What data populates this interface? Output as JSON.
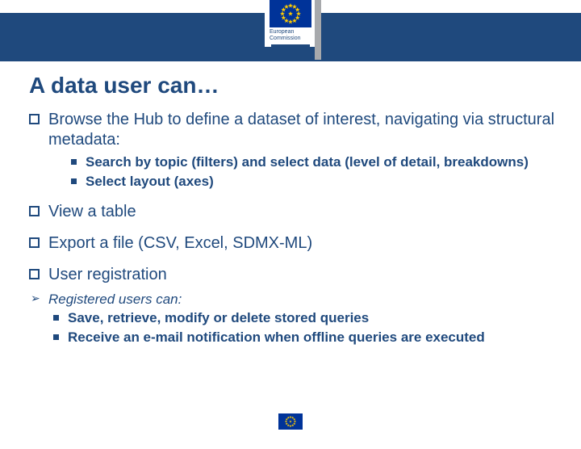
{
  "logo": {
    "caption_l1": "European",
    "caption_l2": "Commission"
  },
  "title": "A data user can…",
  "bullets": {
    "b1": "Browse the Hub to define a dataset of interest, navigating via structural metadata:",
    "b1_s1": "Search by topic (filters) and select data (level of detail, breakdowns)",
    "b1_s2": "Select layout (axes)",
    "b2": "View a table",
    "b3": "Export a file (CSV, Excel, SDMX-ML)",
    "b4": "User registration",
    "reg_intro": "Registered users can:",
    "reg_s1": "Save, retrieve, modify or delete stored queries",
    "reg_s2": "Receive an e-mail notification when offline queries are executed"
  }
}
